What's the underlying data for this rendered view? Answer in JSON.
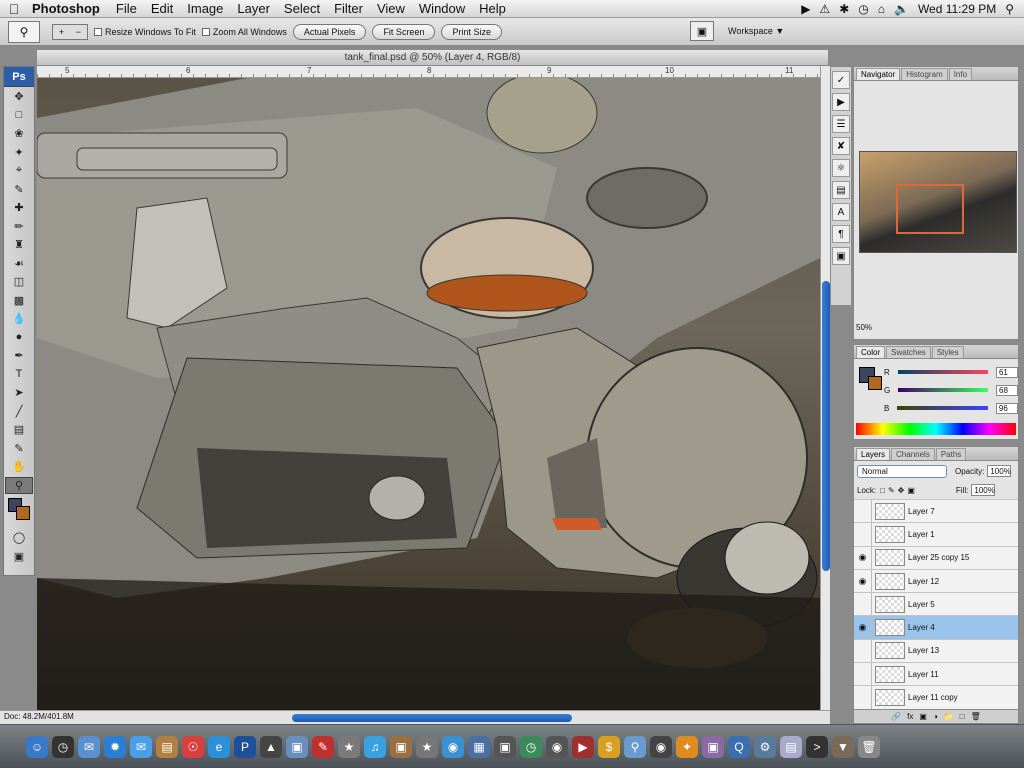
{
  "menubar": {
    "app_name": "Photoshop",
    "items": [
      "File",
      "Edit",
      "Image",
      "Layer",
      "Select",
      "Filter",
      "View",
      "Window",
      "Help"
    ],
    "clock": "Wed 11:29 PM"
  },
  "options": {
    "resize_windows": "Resize Windows To Fit",
    "zoom_all": "Zoom All Windows",
    "actual_pixels": "Actual Pixels",
    "fit_screen": "Fit Screen",
    "print_size": "Print Size",
    "workspace": "Workspace"
  },
  "toolbox": {
    "logo": "Ps"
  },
  "document": {
    "title": "tank_final.psd @ 50% (Layer 4, RGB/8)",
    "ruler_ticks": [
      "5",
      "6",
      "7",
      "8",
      "9",
      "10",
      "11"
    ],
    "status": "Doc: 48.2M/401.8M"
  },
  "navigator": {
    "tabs": [
      "Navigator",
      "Histogram",
      "Info"
    ],
    "zoom": "50%"
  },
  "color": {
    "tabs": [
      "Color",
      "Swatches",
      "Styles"
    ],
    "r_label": "R",
    "g_label": "G",
    "b_label": "B",
    "r": "61",
    "g": "68",
    "b": "96",
    "fg_hex": "#3d4460",
    "bg_hex": "#b06a20"
  },
  "layers": {
    "tabs": [
      "Layers",
      "Channels",
      "Paths"
    ],
    "blend_mode": "Normal",
    "opacity_label": "Opacity:",
    "opacity": "100%",
    "lock_label": "Lock:",
    "fill_label": "Fill:",
    "fill": "100%",
    "rows": [
      {
        "name": "Layer 7",
        "visible": false,
        "selected": false
      },
      {
        "name": "Layer 1",
        "visible": false,
        "selected": false
      },
      {
        "name": "Layer 25 copy 15",
        "visible": true,
        "selected": false
      },
      {
        "name": "Layer 12",
        "visible": true,
        "selected": false
      },
      {
        "name": "Layer 5",
        "visible": false,
        "selected": false
      },
      {
        "name": "Layer 4",
        "visible": true,
        "selected": true
      },
      {
        "name": "Layer 13",
        "visible": false,
        "selected": false
      },
      {
        "name": "Layer 11",
        "visible": false,
        "selected": false
      },
      {
        "name": "Layer 11 copy",
        "visible": false,
        "selected": false
      }
    ]
  }
}
